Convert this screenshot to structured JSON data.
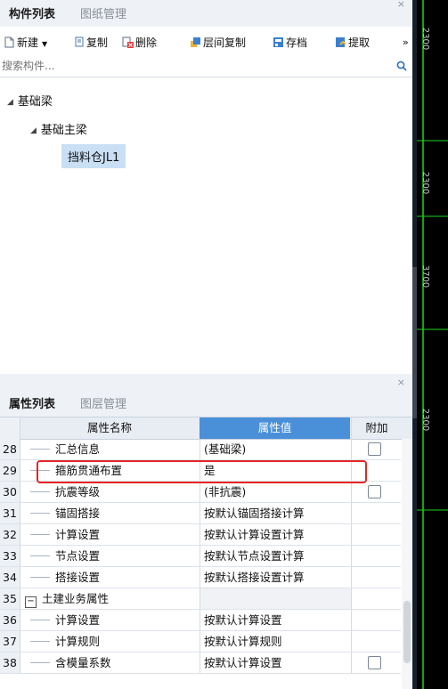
{
  "top_panel": {
    "tabs": [
      {
        "label": "构件列表"
      },
      {
        "label": "图纸管理"
      }
    ],
    "close": "×",
    "toolbar": {
      "new_label": "新建",
      "copy_label": "复制",
      "delete_label": "删除",
      "floor_copy_label": "层间复制",
      "archive_label": "存档",
      "extract_label": "提取",
      "more_label": "»"
    },
    "search": {
      "placeholder": "搜索构件..."
    },
    "tree": {
      "level1": "基础梁",
      "level2": "基础主梁",
      "level3": "挡料仓JL1"
    }
  },
  "bottom_panel": {
    "tabs": [
      {
        "label": "属性列表"
      },
      {
        "label": "图层管理"
      }
    ],
    "close": "×",
    "headers": {
      "name": "属性名称",
      "value": "属性值",
      "extra": "附加"
    },
    "rows": [
      {
        "num": "28",
        "name": "汇总信息",
        "value": "(基础梁)",
        "check": true
      },
      {
        "num": "29",
        "name": "箍筋贯通布置",
        "value": "是",
        "check": false
      },
      {
        "num": "30",
        "name": "抗震等级",
        "value": "(非抗震)",
        "check": true
      },
      {
        "num": "31",
        "name": "锚固搭接",
        "value": "按默认锚固搭接计算",
        "check": false
      },
      {
        "num": "32",
        "name": "计算设置",
        "value": "按默认计算设置计算",
        "check": false
      },
      {
        "num": "33",
        "name": "节点设置",
        "value": "按默认节点设置计算",
        "check": false
      },
      {
        "num": "34",
        "name": "搭接设置",
        "value": "按默认搭接设置计算",
        "check": false
      },
      {
        "num": "35",
        "name": "土建业务属性",
        "value": "",
        "check": false,
        "group": true
      },
      {
        "num": "36",
        "name": "计算设置",
        "value": "按默认计算设置",
        "check": false
      },
      {
        "num": "37",
        "name": "计算规则",
        "value": "按默认计算规则",
        "check": false
      },
      {
        "num": "38",
        "name": "含模量系数",
        "value": "按默认计算设置",
        "check": true
      }
    ]
  },
  "colors": {
    "accent": "#4a90d9",
    "highlight": "#e32626",
    "selection": "#c9dff4",
    "grid_line": "#1ed61e"
  },
  "drawing": {
    "labels": [
      "2300",
      "2300",
      "3700",
      "2300"
    ]
  }
}
